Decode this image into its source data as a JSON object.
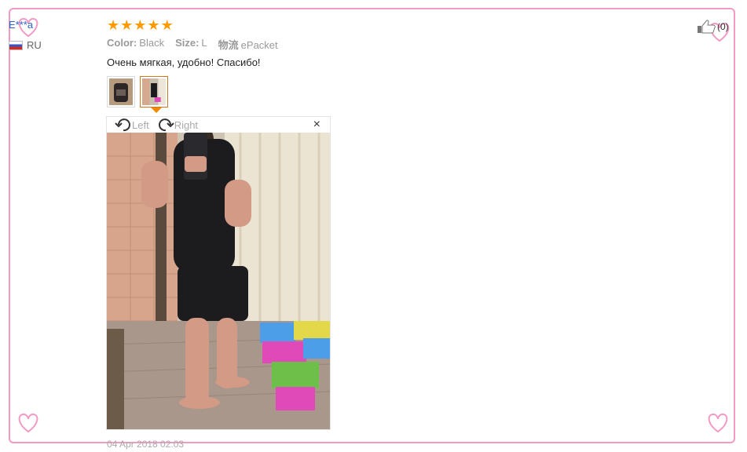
{
  "review": {
    "user_name": "E***a",
    "country": "RU",
    "rating": 5,
    "attributes": [
      {
        "key": "Color:",
        "value": "Black"
      },
      {
        "key": "Size:",
        "value": "L"
      },
      {
        "key": "物流",
        "value": "ePacket"
      }
    ],
    "text": "Очень мягкая, удобно! Спасибо!",
    "date": "04 Apr 2018 02:03",
    "likes": "(0)"
  },
  "viewer": {
    "rotate_left_label": "Left",
    "rotate_right_label": "Right",
    "close_symbol": "×"
  },
  "icons": {
    "star": "star-icon",
    "rotate_left": "rotate-left-icon",
    "rotate_right": "rotate-right-icon",
    "close": "close-icon",
    "thumb_up": "thumbs-up-icon",
    "flag": "flag-ru-icon"
  },
  "colors": {
    "accent": "#ff9a00",
    "frame": "#f39ac4",
    "username": "#2a62c8",
    "active_thumb": "#d07520"
  }
}
